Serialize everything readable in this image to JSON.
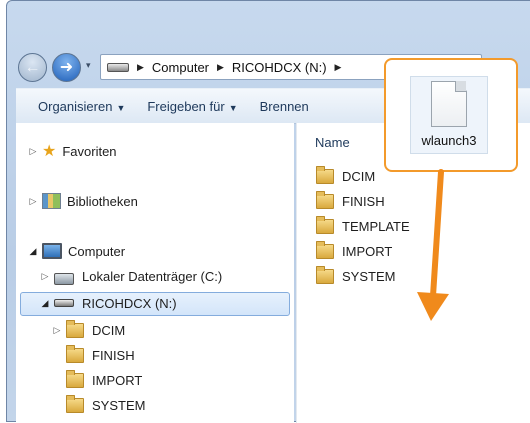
{
  "address_bar": {
    "crumbs": [
      "Computer",
      "RICOHDCX (N:)"
    ]
  },
  "toolbar": {
    "organize_label": "Organisieren",
    "share_label": "Freigeben für",
    "burn_label": "Brennen"
  },
  "nav_tree": {
    "favorites": "Favoriten",
    "libraries": "Bibliotheken",
    "computer": "Computer",
    "local_disk": "Lokaler Datenträger (C:)",
    "selected_drive": "RICOHDCX (N:)",
    "drive_folders": [
      "DCIM",
      "FINISH",
      "IMPORT",
      "SYSTEM"
    ]
  },
  "content": {
    "column_name": "Name",
    "folders": [
      "DCIM",
      "FINISH",
      "TEMPLATE",
      "IMPORT",
      "SYSTEM"
    ]
  },
  "drag": {
    "file_name": "wlaunch3",
    "highlight_color": "#f39a2b",
    "arrow_color": "#f08a1c"
  }
}
